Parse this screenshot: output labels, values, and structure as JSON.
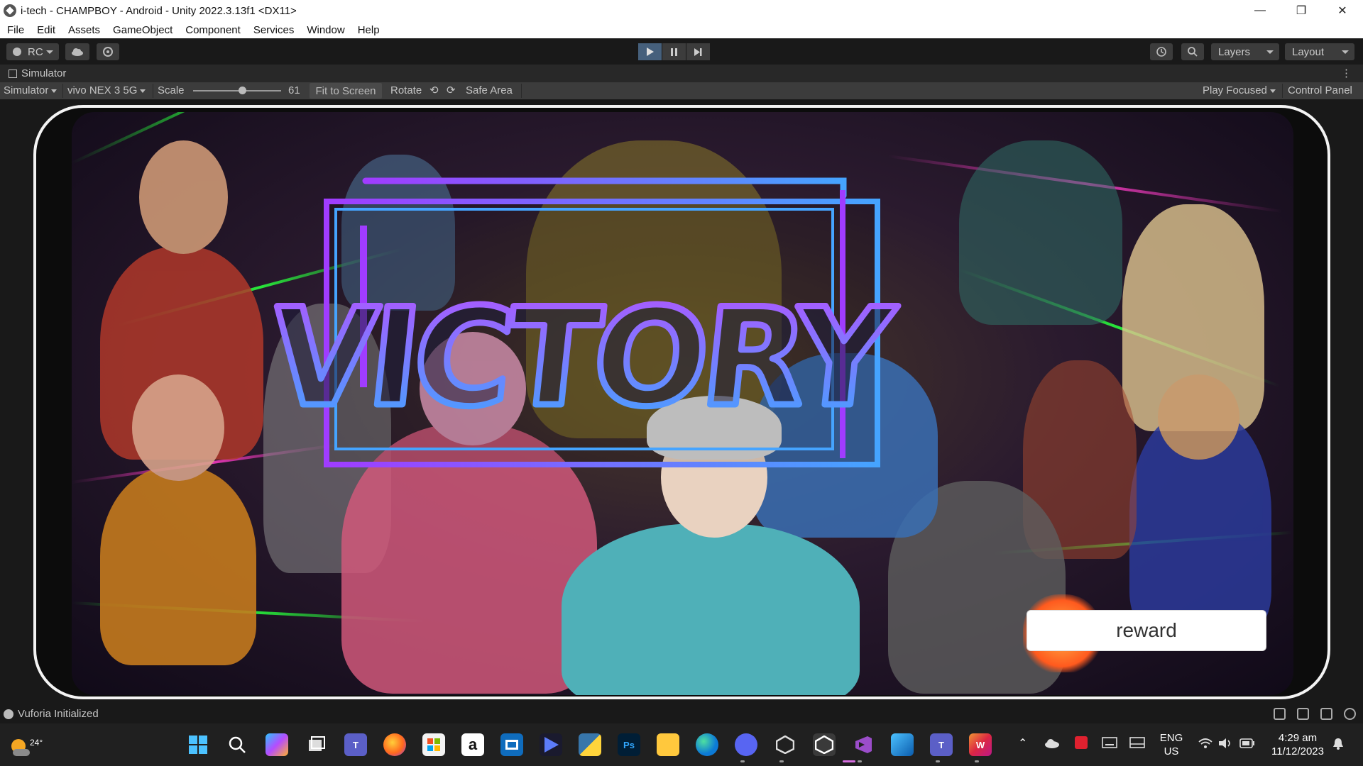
{
  "window": {
    "title": "i-tech - CHAMPBOY - Android - Unity 2022.3.13f1 <DX11>",
    "controls": [
      "—",
      "❐",
      "✕"
    ]
  },
  "menu": [
    "File",
    "Edit",
    "Assets",
    "GameObject",
    "Component",
    "Services",
    "Window",
    "Help"
  ],
  "toolbar": {
    "account_label": "RC",
    "layers_label": "Layers",
    "layout_label": "Layout",
    "play_state": "playing"
  },
  "simulator": {
    "tab_label": "Simulator",
    "mode_label": "Simulator",
    "device_label": "vivo NEX 3 5G",
    "scale_label": "Scale",
    "scale_value": "61",
    "fit_label": "Fit to Screen",
    "rotate_label": "Rotate",
    "safe_area_label": "Safe Area",
    "play_focused_label": "Play Focused",
    "control_panel_label": "Control Panel"
  },
  "game": {
    "victory_text": "VICTORY",
    "reward_label": "reward",
    "colors": {
      "victory_fill_top": "#b552ff",
      "victory_fill_bottom": "#3da7ff",
      "frame_purple": "#a03cff",
      "frame_blue": "#45a4ff",
      "laser_green": "#2cff3c"
    }
  },
  "status": {
    "message": "Vuforia Initialized"
  },
  "taskbar": {
    "temperature": "24°",
    "language_line1": "ENG",
    "language_line2": "US",
    "time": "4:29 am",
    "date": "11/12/2023",
    "apps": [
      "windows-start",
      "search",
      "copilot",
      "task-view",
      "teams",
      "firefox",
      "store",
      "amazon",
      "photos",
      "prime",
      "python",
      "photoshop",
      "file-explorer",
      "edge",
      "discord",
      "unity-hub",
      "unity",
      "visual-studio",
      "paint",
      "teams-work",
      "instagram"
    ]
  }
}
